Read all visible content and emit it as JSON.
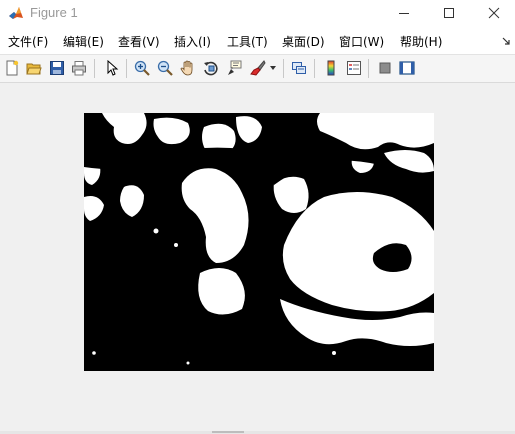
{
  "window": {
    "title": "Figure 1",
    "icon": "matlab-icon",
    "controls": [
      "minimize-icon",
      "maximize-icon",
      "close-icon"
    ]
  },
  "menubar": {
    "items": [
      {
        "label": "文件(F)"
      },
      {
        "label": "编辑(E)"
      },
      {
        "label": "查看(V)"
      },
      {
        "label": "插入(I)"
      },
      {
        "label": "工具(T)"
      },
      {
        "label": "桌面(D)"
      },
      {
        "label": "窗口(W)"
      },
      {
        "label": "帮助(H)"
      }
    ],
    "overflow_icon": "menu-arrow-icon"
  },
  "toolbar": {
    "buttons": [
      "new-figure-icon",
      "open-file-icon",
      "save-icon",
      "print-icon",
      "edit-plot-arrow-icon",
      "zoom-in-icon",
      "zoom-out-icon",
      "pan-hand-icon",
      "rotate-3d-icon",
      "data-cursor-icon",
      "brush-icon",
      "link-plot-icon",
      "insert-colorbar-icon",
      "insert-legend-icon",
      "hide-plot-tools-icon",
      "show-plot-tools-icon"
    ]
  },
  "figure": {
    "content": "binary-image",
    "colors": {
      "foreground": "#ffffff",
      "background": "#000000"
    }
  }
}
